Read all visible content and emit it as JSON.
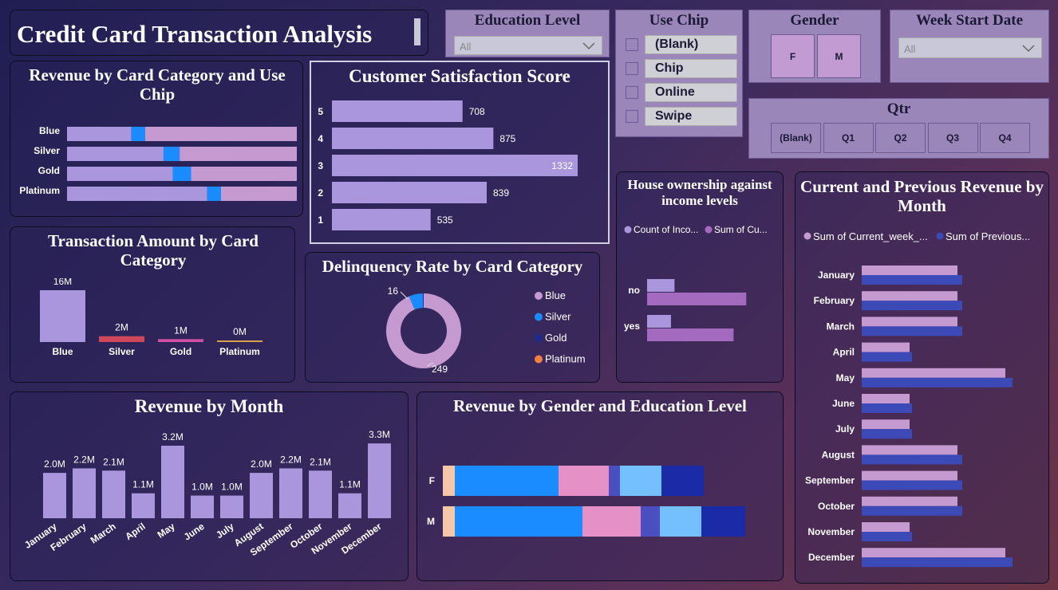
{
  "title": "Credit Card Transaction Analysis",
  "slicers": {
    "education": {
      "title": "Education Level",
      "value": "All"
    },
    "use_chip": {
      "title": "Use Chip",
      "options": [
        "(Blank)",
        "Chip",
        "Online",
        "Swipe"
      ]
    },
    "gender": {
      "title": "Gender",
      "options": [
        "F",
        "M"
      ]
    },
    "week": {
      "title": "Week Start Date",
      "value": "All"
    },
    "qtr": {
      "title": "Qtr",
      "options": [
        "(Blank)",
        "Q1",
        "Q2",
        "Q3",
        "Q4"
      ]
    }
  },
  "colors": {
    "lavender": "#a996dc",
    "pink": "#c59ad0",
    "blue_chip": "#1a8cff",
    "red": "#d0465a",
    "magenta": "#d34fa6",
    "gold_line": "#d8a24a",
    "purple_bar": "#a46ac0",
    "navy": "#3c4ab8"
  },
  "chart_data": [
    {
      "id": "revenue_by_card_category_use_chip",
      "type": "bar",
      "orientation": "horizontal-stacked-100",
      "title": "Revenue by Card Category and Use Chip",
      "categories": [
        "Blue",
        "Silver",
        "Gold",
        "Platinum"
      ],
      "series": [
        {
          "values": [
            0.28,
            0.42,
            0.46,
            0.61
          ]
        },
        {
          "values": [
            0.06,
            0.07,
            0.08,
            0.06
          ]
        },
        {
          "values": [
            0.66,
            0.51,
            0.46,
            0.33
          ]
        }
      ]
    },
    {
      "id": "customer_satisfaction_score",
      "type": "bar",
      "orientation": "horizontal",
      "title": "Customer Satisfaction Score",
      "categories": [
        "5",
        "4",
        "3",
        "2",
        "1"
      ],
      "values": [
        708,
        875,
        1332,
        839,
        535
      ],
      "xlim": [
        0,
        1700
      ]
    },
    {
      "id": "transaction_amount_by_card_category",
      "type": "bar",
      "title": "Transaction Amount by Card Category",
      "categories": [
        "Blue",
        "Silver",
        "Gold",
        "Platinum"
      ],
      "values": [
        16,
        2,
        1,
        0
      ],
      "data_labels": [
        "16M",
        "2M",
        "1M",
        "0M"
      ],
      "bar_heights_m": [
        16,
        1.8,
        0.9,
        0.2
      ],
      "ylim": [
        0,
        17
      ]
    },
    {
      "id": "delinquency_rate_by_card_category",
      "type": "pie",
      "variant": "donut",
      "title": "Delinquency Rate by Card Category",
      "legend": [
        "Blue",
        "Silver",
        "Gold",
        "Platinum"
      ],
      "legend_colors": [
        "#c59ad0",
        "#1a8cff",
        "#1f2a8c",
        "#f08040"
      ],
      "values": [
        249,
        16,
        1,
        0
      ],
      "data_labels": [
        "249",
        "16"
      ]
    },
    {
      "id": "house_ownership_income",
      "type": "bar",
      "orientation": "horizontal",
      "title": "House ownership against income levels",
      "categories": [
        "no",
        "yes"
      ],
      "series": [
        {
          "name": "Count of Inco...",
          "values": [
            39,
            34
          ]
        },
        {
          "name": "Sum of Cu...",
          "values": [
            141,
            123
          ]
        }
      ],
      "xlim": [
        0,
        160
      ]
    },
    {
      "id": "current_previous_revenue_by_month",
      "type": "bar",
      "orientation": "horizontal-grouped",
      "title": "Current and Previous Revenue by Month",
      "categories": [
        "January",
        "February",
        "March",
        "April",
        "May",
        "June",
        "July",
        "August",
        "September",
        "October",
        "November",
        "December"
      ],
      "series": [
        {
          "name": "Sum of Current_week_...",
          "values": [
            2.0,
            2.0,
            2.0,
            1.0,
            3.0,
            1.0,
            1.0,
            2.0,
            2.0,
            2.0,
            1.0,
            3.0
          ]
        },
        {
          "name": "Sum of Previous...",
          "values": [
            2.1,
            2.1,
            2.1,
            1.05,
            3.15,
            1.05,
            1.05,
            2.1,
            2.1,
            2.1,
            1.05,
            3.15
          ]
        }
      ],
      "xlim": [
        0,
        3.9
      ]
    },
    {
      "id": "revenue_by_month",
      "type": "bar",
      "title": "Revenue by Month",
      "categories": [
        "January",
        "February",
        "March",
        "April",
        "May",
        "June",
        "July",
        "August",
        "September",
        "October",
        "November",
        "December"
      ],
      "values": [
        2.0,
        2.2,
        2.1,
        1.1,
        3.2,
        1.0,
        1.0,
        2.0,
        2.2,
        2.1,
        1.1,
        3.3
      ],
      "data_labels": [
        "2.0M",
        "2.2M",
        "2.1M",
        "1.1M",
        "3.2M",
        "1.0M",
        "1.0M",
        "2.0M",
        "2.2M",
        "2.1M",
        "1.1M",
        "3.3M"
      ],
      "ylim": [
        0,
        3.6
      ]
    },
    {
      "id": "revenue_by_gender_education",
      "type": "bar",
      "orientation": "horizontal-stacked",
      "title": "Revenue by Gender and Education Level",
      "categories": [
        "F",
        "M"
      ],
      "segment_colors": [
        "#f6c6a8",
        "#1a8cff",
        "#e690c8",
        "#4a4ebf",
        "#74c0ff",
        "#1b2aa6"
      ],
      "series": [
        {
          "values": [
            0.15,
            0.15
          ]
        },
        {
          "values": [
            1.3,
            1.6
          ]
        },
        {
          "values": [
            0.63,
            0.73
          ]
        },
        {
          "values": [
            0.14,
            0.24
          ]
        },
        {
          "values": [
            0.52,
            0.52
          ]
        },
        {
          "values": [
            0.53,
            0.55
          ]
        }
      ],
      "xlim": [
        0,
        4.1
      ]
    }
  ]
}
